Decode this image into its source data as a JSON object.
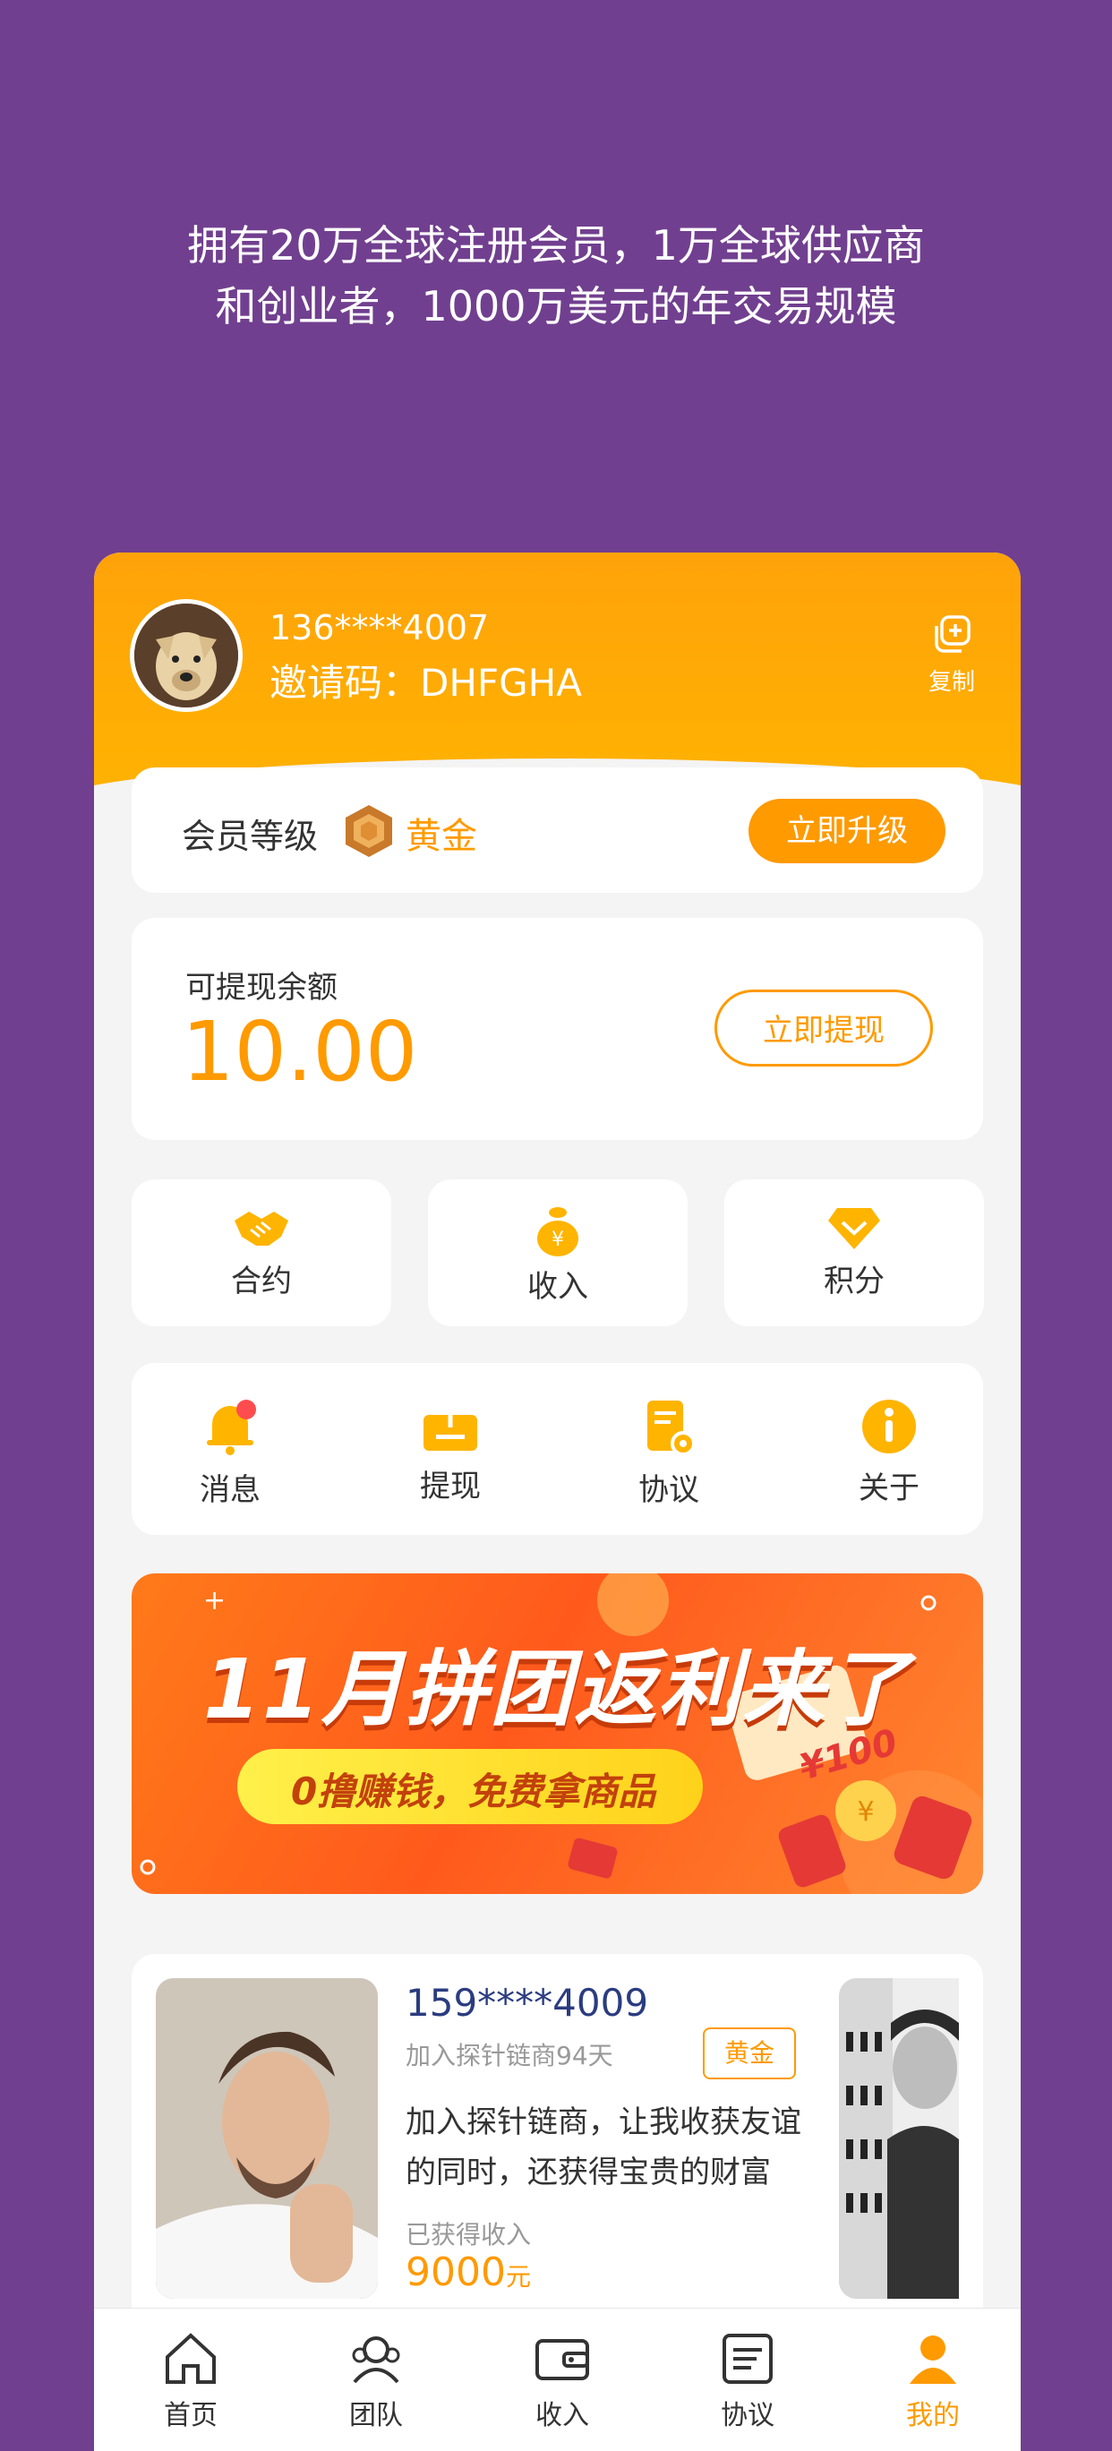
{
  "tagline": {
    "line1": "拥有20万全球注册会员，1万全球供应商",
    "line2": "和创业者，1000万美元的年交易规模"
  },
  "profile": {
    "phone": "136****4007",
    "invite": "邀请码：DHFGHA",
    "copy_label": "复制"
  },
  "membership": {
    "label": "会员等级",
    "level": "黄金",
    "upgrade_label": "立即升级"
  },
  "balance": {
    "label": "可提现余额",
    "amount": "10.00",
    "withdraw_label": "立即提现"
  },
  "quick_actions": [
    {
      "label": "合约",
      "icon": "handshake-icon"
    },
    {
      "label": "收入",
      "icon": "money-bag-icon"
    },
    {
      "label": "积分",
      "icon": "diamond-icon"
    }
  ],
  "menu": [
    {
      "label": "消息",
      "icon": "bell-icon"
    },
    {
      "label": "提现",
      "icon": "withdraw-box-icon"
    },
    {
      "label": "协议",
      "icon": "document-icon"
    },
    {
      "label": "关于",
      "icon": "info-icon"
    }
  ],
  "banner": {
    "title": "11月拼团返利来了",
    "subtitle": "0撸赚钱，免费拿商品",
    "coupon": "¥100"
  },
  "user_card": {
    "phone": "159****4009",
    "joined": "加入探针链商94天",
    "badge": "黄金",
    "desc": "加入探针链商，让我收获友谊的同时，还获得宝贵的财富",
    "earn_label": "已获得收入",
    "earn_value": "9000",
    "earn_unit": "元"
  },
  "tabbar": [
    {
      "label": "首页",
      "icon": "home-icon"
    },
    {
      "label": "团队",
      "icon": "team-icon"
    },
    {
      "label": "收入",
      "icon": "wallet-icon"
    },
    {
      "label": "协议",
      "icon": "list-icon"
    },
    {
      "label": "我的",
      "icon": "user-icon",
      "active": true
    }
  ],
  "colors": {
    "background": "#713f8f",
    "accent": "#ff9a00",
    "hero": "#ffa20a"
  }
}
